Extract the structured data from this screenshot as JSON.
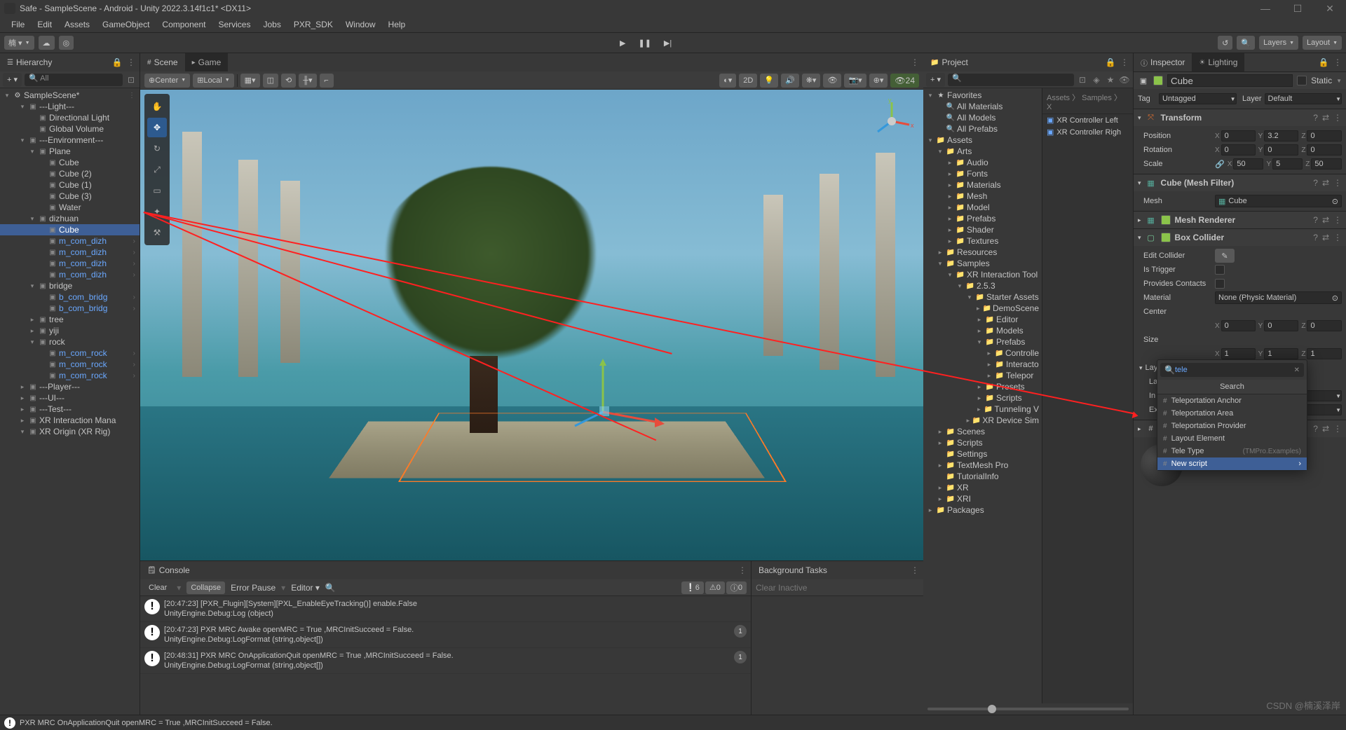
{
  "title": "Safe - SampleScene - Android - Unity 2022.3.14f1c1* <DX11>",
  "menu": [
    "File",
    "Edit",
    "Assets",
    "GameObject",
    "Component",
    "Services",
    "Jobs",
    "PXR_SDK",
    "Window",
    "Help"
  ],
  "toolbar": {
    "acct": "楠 ▾",
    "layers": "Layers",
    "layout": "Layout"
  },
  "play": {
    "play": "▶",
    "pause": "❚❚",
    "step": "▶|"
  },
  "hierarchy": {
    "tab": "Hierarchy",
    "search": "All",
    "root": "SampleScene*",
    "items": [
      {
        "d": 1,
        "f": "▾",
        "n": "---Light---"
      },
      {
        "d": 2,
        "n": "Directional Light"
      },
      {
        "d": 2,
        "n": "Global Volume"
      },
      {
        "d": 1,
        "f": "▾",
        "n": "---Environment---"
      },
      {
        "d": 2,
        "f": "▾",
        "n": "Plane"
      },
      {
        "d": 3,
        "n": "Cube"
      },
      {
        "d": 3,
        "n": "Cube (2)"
      },
      {
        "d": 3,
        "n": "Cube (1)"
      },
      {
        "d": 3,
        "n": "Cube (3)"
      },
      {
        "d": 3,
        "n": "Water"
      },
      {
        "d": 2,
        "f": "▾",
        "n": "dizhuan"
      },
      {
        "d": 3,
        "n": "Cube",
        "sel": true
      },
      {
        "d": 3,
        "n": "m_com_dizh",
        "b": true,
        "c": true
      },
      {
        "d": 3,
        "n": "m_com_dizh",
        "b": true,
        "c": true
      },
      {
        "d": 3,
        "n": "m_com_dizh",
        "b": true,
        "c": true
      },
      {
        "d": 3,
        "n": "m_com_dizh",
        "b": true,
        "c": true
      },
      {
        "d": 2,
        "f": "▾",
        "n": "bridge"
      },
      {
        "d": 3,
        "n": "b_com_bridg",
        "b": true,
        "c": true
      },
      {
        "d": 3,
        "n": "b_com_bridg",
        "b": true,
        "c": true
      },
      {
        "d": 2,
        "f": "▸",
        "n": "tree"
      },
      {
        "d": 2,
        "f": "▸",
        "n": "yiji"
      },
      {
        "d": 2,
        "f": "▾",
        "n": "rock"
      },
      {
        "d": 3,
        "n": "m_com_rock",
        "b": true,
        "c": true
      },
      {
        "d": 3,
        "n": "m_com_rock",
        "b": true,
        "c": true
      },
      {
        "d": 3,
        "n": "m_com_rock",
        "b": true,
        "c": true
      },
      {
        "d": 1,
        "f": "▸",
        "n": "---Player---"
      },
      {
        "d": 1,
        "f": "▸",
        "n": "---UI---"
      },
      {
        "d": 1,
        "f": "▸",
        "n": "---Test---"
      },
      {
        "d": 1,
        "f": "▸",
        "n": "XR Interaction Mana"
      },
      {
        "d": 1,
        "f": "▾",
        "n": "XR Origin (XR Rig)"
      }
    ]
  },
  "scene": {
    "tab1": "Scene",
    "tab2": "Game",
    "center": "Center",
    "local": "Local",
    "mode2d": "2D",
    "visCount": "24"
  },
  "console": {
    "tab": "Console",
    "clear": "Clear",
    "collapse": "Collapse",
    "errpause": "Error Pause",
    "editor": "Editor ▾",
    "counts": {
      "err": "6",
      "warn": "0",
      "info": "0"
    },
    "entries": [
      {
        "l1": "[20:47:23] [PXR_Flugin][System][PXL_EnableEyeTracking()] enable.False",
        "l2": "UnityEngine.Debug:Log (object)",
        "cnt": ""
      },
      {
        "l1": "[20:47:23] PXR MRC Awake openMRC = True ,MRCInitSucceed = False.",
        "l2": "UnityEngine.Debug:LogFormat (string,object[])",
        "cnt": "1"
      },
      {
        "l1": "[20:48:31] PXR MRC OnApplicationQuit openMRC = True ,MRCInitSucceed = False.",
        "l2": "UnityEngine.Debug:LogFormat (string,object[])",
        "cnt": "1"
      }
    ]
  },
  "bgtasks": {
    "tab": "Background Tasks",
    "clear": "Clear Inactive"
  },
  "project": {
    "tab": "Project",
    "breadcrumb": "Assets 〉 Samples 〉 X",
    "results": [
      "XR Controller Left",
      "XR Controller Righ"
    ],
    "tree": [
      {
        "d": 0,
        "f": "▾",
        "n": "Favorites",
        "i": "★"
      },
      {
        "d": 1,
        "n": "All Materials",
        "i": "🔍"
      },
      {
        "d": 1,
        "n": "All Models",
        "i": "🔍"
      },
      {
        "d": 1,
        "n": "All Prefabs",
        "i": "🔍"
      },
      {
        "d": 0,
        "f": "▾",
        "n": "Assets",
        "i": "📁"
      },
      {
        "d": 1,
        "f": "▾",
        "n": "Arts",
        "i": "📁"
      },
      {
        "d": 2,
        "f": "▸",
        "n": "Audio",
        "i": "📁"
      },
      {
        "d": 2,
        "f": "▸",
        "n": "Fonts",
        "i": "📁"
      },
      {
        "d": 2,
        "f": "▸",
        "n": "Materials",
        "i": "📁"
      },
      {
        "d": 2,
        "f": "▸",
        "n": "Mesh",
        "i": "📁"
      },
      {
        "d": 2,
        "f": "▸",
        "n": "Model",
        "i": "📁"
      },
      {
        "d": 2,
        "f": "▸",
        "n": "Prefabs",
        "i": "📁"
      },
      {
        "d": 2,
        "f": "▸",
        "n": "Shader",
        "i": "📁"
      },
      {
        "d": 2,
        "f": "▸",
        "n": "Textures",
        "i": "📁"
      },
      {
        "d": 1,
        "f": "▸",
        "n": "Resources",
        "i": "📁"
      },
      {
        "d": 1,
        "f": "▾",
        "n": "Samples",
        "i": "📁"
      },
      {
        "d": 2,
        "f": "▾",
        "n": "XR Interaction Tool",
        "i": "📁"
      },
      {
        "d": 3,
        "f": "▾",
        "n": "2.5.3",
        "i": "📁"
      },
      {
        "d": 4,
        "f": "▾",
        "n": "Starter Assets",
        "i": "📁"
      },
      {
        "d": 5,
        "f": "▸",
        "n": "DemoScene",
        "i": "📁"
      },
      {
        "d": 5,
        "f": "▸",
        "n": "Editor",
        "i": "📁"
      },
      {
        "d": 5,
        "f": "▸",
        "n": "Models",
        "i": "📁"
      },
      {
        "d": 5,
        "f": "▾",
        "n": "Prefabs",
        "i": "📁"
      },
      {
        "d": 6,
        "f": "▸",
        "n": "Controlle",
        "i": "📁"
      },
      {
        "d": 6,
        "f": "▸",
        "n": "Interacto",
        "i": "📁"
      },
      {
        "d": 6,
        "f": "▸",
        "n": "Telepor",
        "i": "📁"
      },
      {
        "d": 5,
        "f": "▸",
        "n": "Presets",
        "i": "📁"
      },
      {
        "d": 5,
        "f": "▸",
        "n": "Scripts",
        "i": "📁"
      },
      {
        "d": 5,
        "f": "▸",
        "n": "Tunneling V",
        "i": "📁"
      },
      {
        "d": 4,
        "f": "▸",
        "n": "XR Device Sim",
        "i": "📁"
      },
      {
        "d": 1,
        "f": "▸",
        "n": "Scenes",
        "i": "📁"
      },
      {
        "d": 1,
        "f": "▸",
        "n": "Scripts",
        "i": "📁"
      },
      {
        "d": 1,
        "n": "Settings",
        "i": "📁"
      },
      {
        "d": 1,
        "f": "▸",
        "n": "TextMesh Pro",
        "i": "📁"
      },
      {
        "d": 1,
        "n": "TutorialInfo",
        "i": "📁"
      },
      {
        "d": 1,
        "f": "▸",
        "n": "XR",
        "i": "📁"
      },
      {
        "d": 1,
        "f": "▸",
        "n": "XRI",
        "i": "📁"
      },
      {
        "d": 0,
        "f": "▸",
        "n": "Packages",
        "i": "📁"
      }
    ]
  },
  "inspector": {
    "tab1": "Inspector",
    "tab2": "Lighting",
    "name": "Cube",
    "static": "Static",
    "tag": "Tag",
    "tagv": "Untagged",
    "layer": "Layer",
    "layerv": "Default",
    "transform": {
      "title": "Transform",
      "pos": "Position",
      "rot": "Rotation",
      "scl": "Scale",
      "px": "0",
      "py": "3.2",
      "pz": "0",
      "rx": "0",
      "ry": "0",
      "rz": "0",
      "sx": "50",
      "sy": "5",
      "sz": "50"
    },
    "meshfilter": {
      "title": "Cube (Mesh Filter)",
      "mesh": "Mesh",
      "meshv": "Cube"
    },
    "meshrend": "Mesh Renderer",
    "boxcol": {
      "title": "Box Collider",
      "edit": "Edit Collider",
      "istrig": "Is Trigger",
      "prov": "Provides Contacts",
      "mat": "Material",
      "matv": "None (Physic Material)",
      "center": "Center",
      "size": "Size",
      "cx": "0",
      "cy": "0",
      "cz": "0",
      "sx": "1",
      "sy": "1",
      "sz": "1"
    },
    "layLbl": "Lay",
    "laLbl": "La",
    "inLbl": "In",
    "exLbl": "Ex"
  },
  "popup": {
    "query": "tele",
    "hdr": "Search",
    "opts": [
      {
        "n": "Teleportation Anchor"
      },
      {
        "n": "Teleportation Area"
      },
      {
        "n": "Teleportation Provider"
      },
      {
        "n": "Layout Element"
      },
      {
        "n": "Tele Type",
        "sub": "(TMPro.Examples)"
      },
      {
        "n": "New script",
        "sel": true,
        "chev": true
      }
    ]
  },
  "status": "PXR MRC OnApplicationQuit openMRC = True ,MRCInitSucceed = False.",
  "watermark": "CSDN @楠溪泽岸"
}
